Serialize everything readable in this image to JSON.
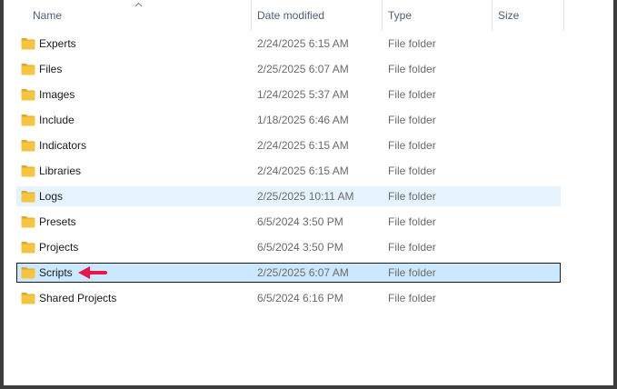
{
  "columns": {
    "name": "Name",
    "date_modified": "Date modified",
    "type": "Type",
    "size": "Size"
  },
  "sort": {
    "column": "name",
    "direction": "ascending",
    "indicator_icon": "sort-caret-up-icon"
  },
  "rows": [
    {
      "name": "Experts",
      "date": "2/24/2025 6:15 AM",
      "type": "File folder",
      "size": ""
    },
    {
      "name": "Files",
      "date": "2/25/2025 6:07 AM",
      "type": "File folder",
      "size": ""
    },
    {
      "name": "Images",
      "date": "1/24/2025 5:37 AM",
      "type": "File folder",
      "size": ""
    },
    {
      "name": "Include",
      "date": "1/18/2025 6:46 AM",
      "type": "File folder",
      "size": ""
    },
    {
      "name": "Indicators",
      "date": "2/24/2025 6:15 AM",
      "type": "File folder",
      "size": ""
    },
    {
      "name": "Libraries",
      "date": "2/24/2025 6:15 AM",
      "type": "File folder",
      "size": ""
    },
    {
      "name": "Logs",
      "date": "2/25/2025 10:11 AM",
      "type": "File folder",
      "size": ""
    },
    {
      "name": "Presets",
      "date": "6/5/2024 3:50 PM",
      "type": "File folder",
      "size": ""
    },
    {
      "name": "Projects",
      "date": "6/5/2024 3:50 PM",
      "type": "File folder",
      "size": ""
    },
    {
      "name": "Scripts",
      "date": "2/25/2025 6:07 AM",
      "type": "File folder",
      "size": ""
    },
    {
      "name": "Shared Projects",
      "date": "6/5/2024 6:16 PM",
      "type": "File folder",
      "size": ""
    }
  ],
  "hovered_row": "Logs",
  "selected_row": "Scripts",
  "icons": {
    "folder": "folder-icon",
    "annotation": "red-arrow-pointer-icon"
  },
  "colors": {
    "folder": "#f5c443",
    "hover": "#e5f3ff",
    "selected": "#cce8ff",
    "arrow": "#e8174a",
    "header_text": "#4c607a"
  }
}
